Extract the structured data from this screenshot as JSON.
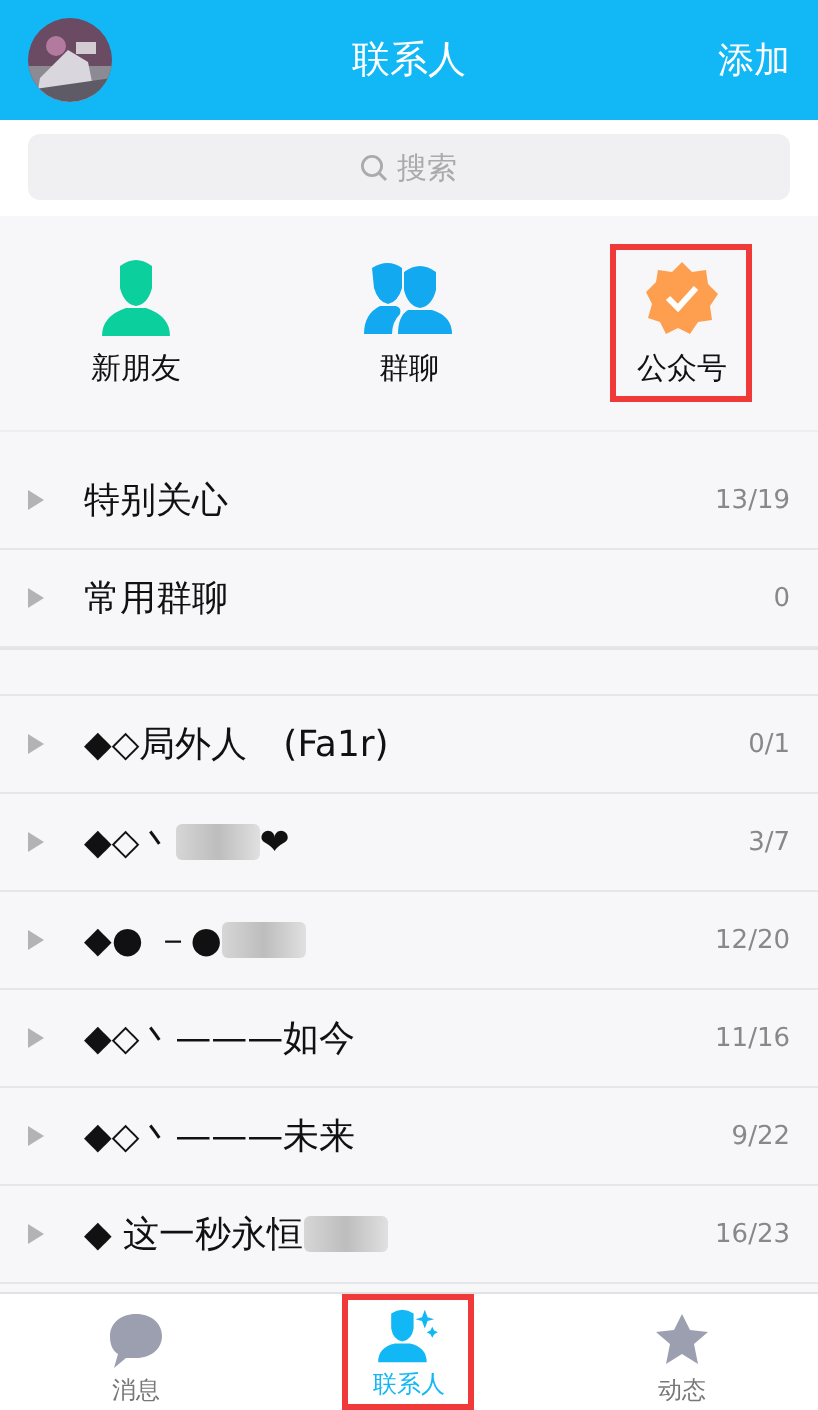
{
  "header": {
    "title": "联系人",
    "action": "添加"
  },
  "search": {
    "placeholder": "搜索"
  },
  "quick_actions": [
    {
      "label": "新朋友",
      "kind": "new-friend",
      "highlighted": false
    },
    {
      "label": "群聊",
      "kind": "group-chat",
      "highlighted": false
    },
    {
      "label": "公众号",
      "kind": "official",
      "highlighted": true
    }
  ],
  "pinned_groups": [
    {
      "name": [
        {
          "kind": "text",
          "text": "特别关心"
        }
      ],
      "count": "13/19"
    },
    {
      "name": [
        {
          "kind": "text",
          "text": "常用群聊"
        }
      ],
      "count": "0"
    }
  ],
  "groups": [
    {
      "name": [
        {
          "kind": "text",
          "text": "◆◇局外人　(Fa1r)"
        }
      ],
      "count": "0/1"
    },
    {
      "name": [
        {
          "kind": "text",
          "text": "◆◇丶"
        },
        {
          "kind": "blur"
        },
        {
          "kind": "text",
          "text": "❤"
        }
      ],
      "count": "3/7"
    },
    {
      "name": [
        {
          "kind": "text",
          "text": "◆● －●"
        },
        {
          "kind": "blur"
        }
      ],
      "count": "12/20"
    },
    {
      "name": [
        {
          "kind": "text",
          "text": "◆◇丶———如今"
        }
      ],
      "count": "11/16"
    },
    {
      "name": [
        {
          "kind": "text",
          "text": "◆◇丶———未来"
        }
      ],
      "count": "9/22"
    },
    {
      "name": [
        {
          "kind": "text",
          "text": "◆ 这一秒永恒"
        },
        {
          "kind": "blur"
        }
      ],
      "count": "16/23"
    }
  ],
  "tabs": [
    {
      "label": "消息",
      "kind": "messages",
      "selected": false,
      "highlighted": false
    },
    {
      "label": "联系人",
      "kind": "contacts",
      "selected": true,
      "highlighted": true
    },
    {
      "label": "动态",
      "kind": "feed",
      "selected": false,
      "highlighted": false
    }
  ]
}
